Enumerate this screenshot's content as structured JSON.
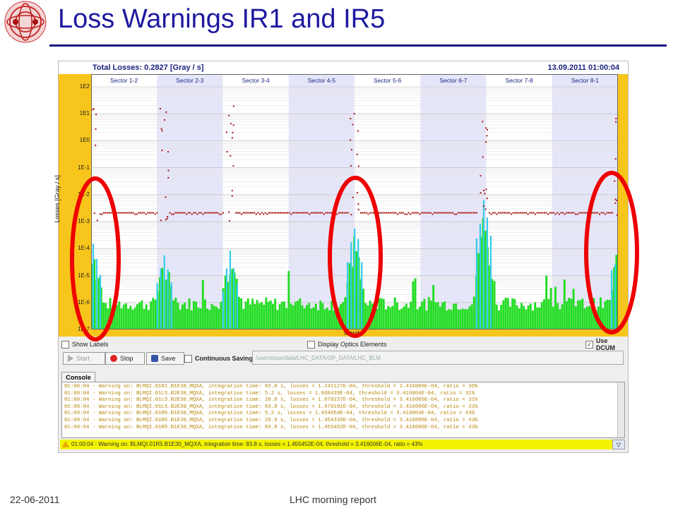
{
  "slide": {
    "title": "Loss Warnings IR1 and IR5",
    "footer_date": "22-06-2011",
    "footer_center": "LHC morning report"
  },
  "plot_header": {
    "total_losses": "Total Losses: 0.2827 [Gray / s]",
    "timestamp": "13.09.2011 01:00:04"
  },
  "chart_data": {
    "type": "bar",
    "ylabel": "Losses [Gray / s]",
    "xlabel_partial": "Monito",
    "y_scale": "log",
    "ylim": [
      1e-07,
      100
    ],
    "y_ticks": [
      "1E2",
      "1E1",
      "1E0",
      "1E-1",
      "1E-2",
      "1E-3",
      "1E-4",
      "1E-5",
      "1E-6",
      "1E-7"
    ],
    "sectors": [
      "Sector 1-2",
      "Sector 2-3",
      "Sector 3-4",
      "Sector 4-5",
      "Sector 5-6",
      "Sector 6-7",
      "Sector 7-8",
      "Sector 8-1"
    ],
    "threshold_level": 0.002,
    "series": [
      {
        "name": "losses",
        "color": "#22dd22"
      },
      {
        "name": "losses-cyan",
        "color": "#33ccee"
      },
      {
        "name": "thresholds",
        "color": "#aa1111"
      }
    ],
    "loss_peaks": [
      {
        "sector_pos": 0.02,
        "value": 0.0002
      },
      {
        "sector_pos": 1.1,
        "value": 0.0001
      },
      {
        "sector_pos": 2.1,
        "value": 9e-05
      },
      {
        "sector_pos": 3.99,
        "value": 0.001
      },
      {
        "sector_pos": 5.95,
        "value": 0.01
      },
      {
        "sector_pos": 8.0,
        "value": 0.0003
      }
    ],
    "highlighted_sectors": [
      1,
      3,
      5,
      7
    ]
  },
  "controls": {
    "show_labels": "Show Labels",
    "display_optics": "Display Optics Elements",
    "use_dcum": "Use DCUM",
    "start": "Start",
    "stop": "Stop",
    "save": "Save",
    "continuous_saving": "Continuous Saving",
    "path": "/user/slops/data/LHC_DATA/OP_DATA/LHC_BLM"
  },
  "console": {
    "tab": "Console",
    "lines": [
      "01:00:04 - Warning on: BLMQI.01R1.B1E30_MQXA, integration time: 83.8 s, losses = 1.241127E-04, threshold = 3.416006E-04, ratio = 36%",
      "01:00:04 - Warning on: BLMQI.01L5.B2E30_MQXA, integration time: 5.2 s, losses = 1.068439E-04, threshold = 3.416004E-04, ratio = 31%",
      "01:00:04 - Warning on: BLMQI.01L5.B2E30_MQXA, integration time: 20.9 s, losses = 1.070237E-04, threshold = 3.416005E-04, ratio = 31%",
      "01:00:04 - Warning on: BLMQI.01L5.B2E30_MQXA, integration time: 83.8 s, losses = 1.070191E-04, threshold = 3.416006E-04, ratio = 31%",
      "01:00:04 - Warning on: BLMQI.01R5.B1E30_MQXA, integration time: 5.2 s, losses = 1.454054E-04, threshold = 3.416004E-04, ratio = 43%",
      "01:00:04 - Warning on: BLMQI.01R5.B1E30_MQXA, integration time: 20.9 s, losses = 1.454335E-04, threshold = 3.416005E-04, ratio = 43%",
      "01:00:04 - Warning on: BLMQI.01R5.B1E30_MQXA, integration time: 83.8 s, losses = 1.455452E-04, threshold = 3.416006E-04, ratio = 43%"
    ]
  },
  "status_bar": "01:00:04 - Warning on: BLMQI.01R5.B1E30_MQXA, integration time: 83.8 s, losses = 1.455452E-04, threshold = 3.416006E-04, ratio = 43%",
  "status_dropdown": "▽"
}
